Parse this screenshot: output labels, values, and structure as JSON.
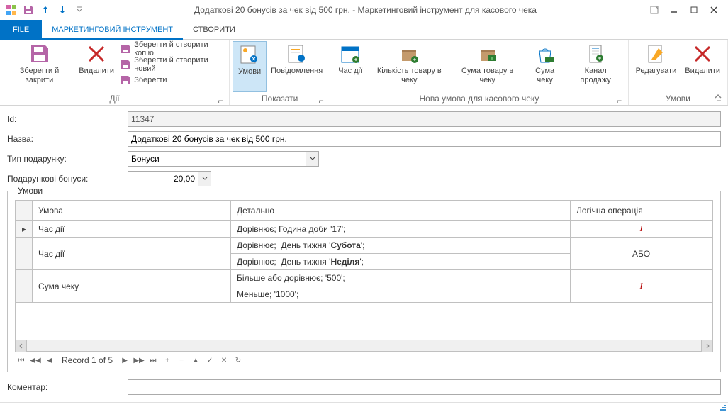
{
  "window": {
    "title": "Додаткові 20 бонусів за чек від 500 грн. - Маркетинговий інструмент для касового чека"
  },
  "tabs": {
    "file": "FILE",
    "marketing": "МАРКЕТИНГОВИЙ ІНСТРУМЕНТ",
    "create": "СТВОРИТИ"
  },
  "ribbon": {
    "groups": {
      "actions": {
        "label": "Дії",
        "save_close": "Зберегти й закрити",
        "delete": "Видалити",
        "save_copy": "Зберегти й створити копію",
        "save_new": "Зберегти й створити новий",
        "save": "Зберегти"
      },
      "show": {
        "label": "Показати",
        "conditions": "Умови",
        "notifications": "Повідомлення"
      },
      "new_condition": {
        "label": "Нова умова для касового чеку",
        "time": "Час дії",
        "items_count": "Кількість товару в чеку",
        "item_amount": "Сума товару в чеку",
        "check_amount": "Сума чеку",
        "sales_channel": "Канал продажу"
      },
      "conditions": {
        "label": "Умови",
        "edit": "Редагувати",
        "delete": "Видалити"
      }
    }
  },
  "form": {
    "id_label": "Id:",
    "id_value": "11347",
    "name_label": "Назва:",
    "name_value": "Додаткові 20 бонусів за чек від 500 грн.",
    "gift_type_label": "Тип подарунку:",
    "gift_type_value": "Бонуси",
    "gift_bonus_label": "Подарункові бонуси:",
    "gift_bonus_value": "20,00",
    "comment_label": "Коментар:",
    "comment_value": ""
  },
  "conditions_group": {
    "title": "Умови",
    "headers": {
      "condition": "Умова",
      "detail": "Детально",
      "logic": "Логічна операція"
    },
    "rows": [
      {
        "condition": "Час дії",
        "detail": "Дорівнює;  Година доби '17';",
        "logic": "І"
      },
      {
        "condition": "Час дії",
        "detail_a": "Дорівнює;  День тижня 'Субота';",
        "detail_b": "Дорівнює;  День тижня 'Неділя';",
        "logic": "АБО"
      },
      {
        "condition": "Сума чеку",
        "detail_a": "Більше або дорівнює;  '500';",
        "detail_b": "Меньше;  '1000';",
        "logic": "І"
      }
    ],
    "navigator": "Record 1 of 5"
  }
}
